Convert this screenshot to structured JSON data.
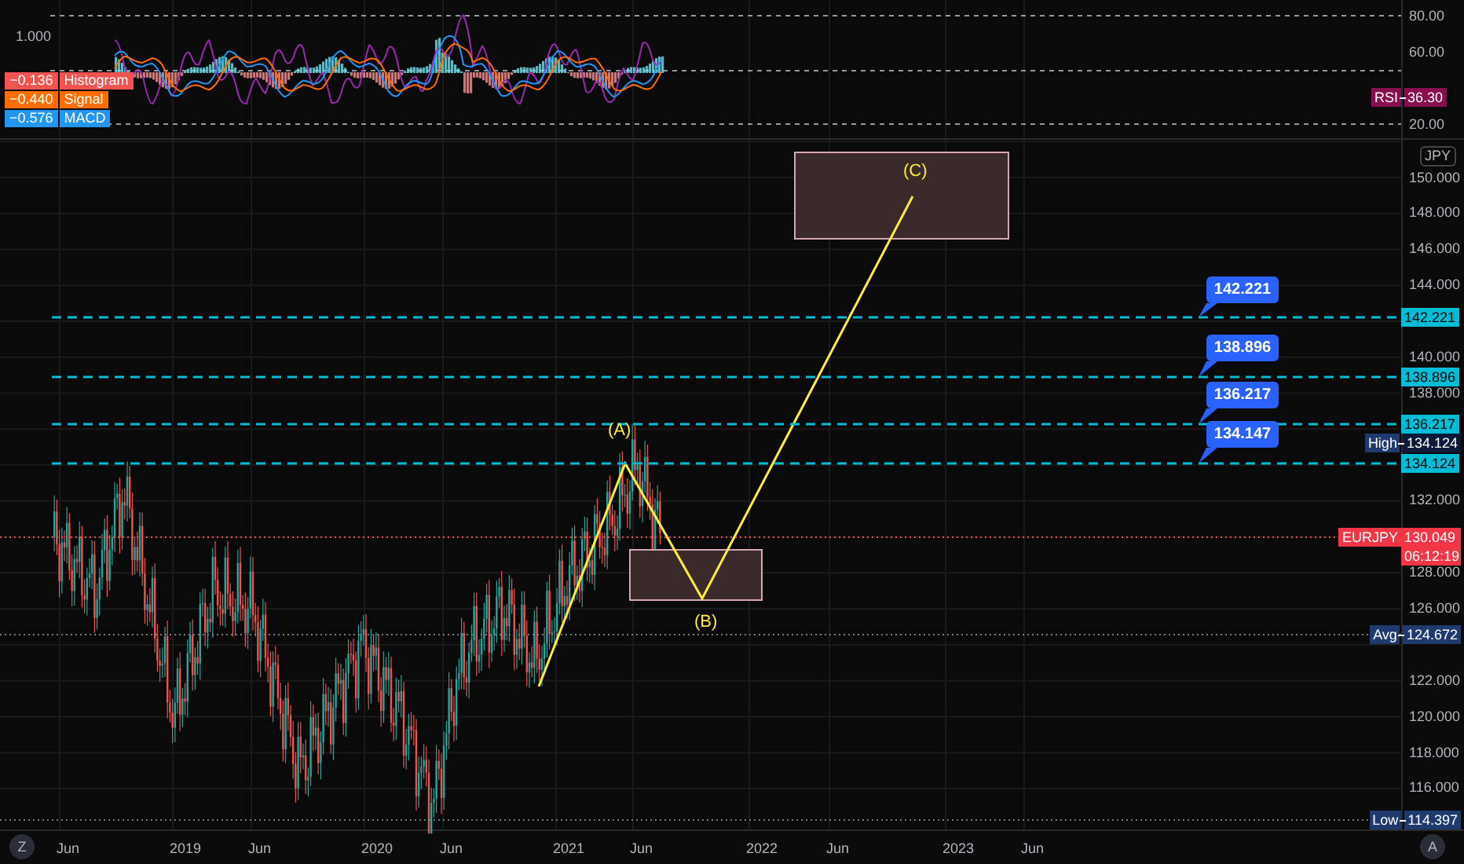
{
  "indicator_pane": {
    "scale_label": "1.000",
    "legend": [
      {
        "value": "−0.136",
        "name": "Histogram",
        "color": "#f05350"
      },
      {
        "value": "−0.440",
        "name": "Signal",
        "color": "#ff6d00"
      },
      {
        "value": "−0.576",
        "name": "MACD",
        "color": "#2196f3"
      }
    ],
    "axis_labels": [
      "80.00",
      "60.00",
      "20.00"
    ],
    "rsi_badge": {
      "name": "RSI",
      "value": "36.30"
    }
  },
  "price_axis": {
    "currency": "JPY",
    "ticks": [
      "150.000",
      "148.000",
      "146.000",
      "144.000",
      "140.000",
      "138.000",
      "132.000",
      "128.000",
      "126.000",
      "122.000",
      "120.000",
      "118.000",
      "116.000"
    ]
  },
  "levels": [
    {
      "callout": "142.221",
      "axis_label": "142.221"
    },
    {
      "callout": "138.896",
      "axis_label": "138.896"
    },
    {
      "callout": "136.217",
      "axis_label": "136.217"
    },
    {
      "callout": "134.147",
      "axis_label": "134.124"
    }
  ],
  "high": {
    "label": "High",
    "value": "134.124"
  },
  "last_price": {
    "symbol": "EURJPY",
    "value": "130.049",
    "countdown": "06:12:19"
  },
  "average": {
    "label": "Avg",
    "value": "124.672"
  },
  "low": {
    "label": "Low",
    "value": "114.397"
  },
  "wave_labels": [
    "(A)",
    "(B)",
    "(C)"
  ],
  "time_axis": {
    "labels": [
      "Jun",
      "2019",
      "Jun",
      "2020",
      "Jun",
      "2021",
      "Jun",
      "2022",
      "Jun",
      "2023",
      "Jun"
    ],
    "left_button": "Z",
    "right_button": "A"
  }
}
